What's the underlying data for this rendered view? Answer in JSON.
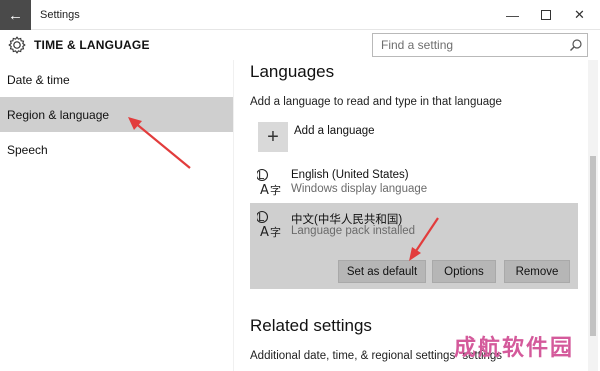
{
  "window": {
    "title": "Settings",
    "back_icon": "arrow-left-icon",
    "controls": [
      "minimize",
      "maximize",
      "close"
    ]
  },
  "header": {
    "title": "TIME & LANGUAGE",
    "icon": "gear-icon",
    "search_placeholder": "Find a setting"
  },
  "nav": {
    "items": [
      {
        "label": "Date & time"
      },
      {
        "label": "Region & language",
        "selected": true
      },
      {
        "label": "Speech"
      }
    ]
  },
  "main": {
    "languages_heading": "Languages",
    "description": "Add a language to read and type in that language",
    "add_language_label": "Add a language",
    "languages": [
      {
        "name": "English (United States)",
        "status": "Windows display language"
      },
      {
        "name": "中文(中华人民共和国)",
        "status": "Language pack installed",
        "selected": true
      }
    ],
    "buttons": {
      "set_default": "Set as default",
      "options": "Options",
      "remove": "Remove"
    },
    "related_heading": "Related settings",
    "related_link": "Additional date, time, & regional settings"
  },
  "watermark": {
    "text": "成航软件园",
    "overlap_text": "settings"
  },
  "colors": {
    "selection": "#cfcfcf",
    "button": "#b6b6b6",
    "annotation_arrow": "#e23c3c",
    "watermark": "#d45a9b"
  }
}
